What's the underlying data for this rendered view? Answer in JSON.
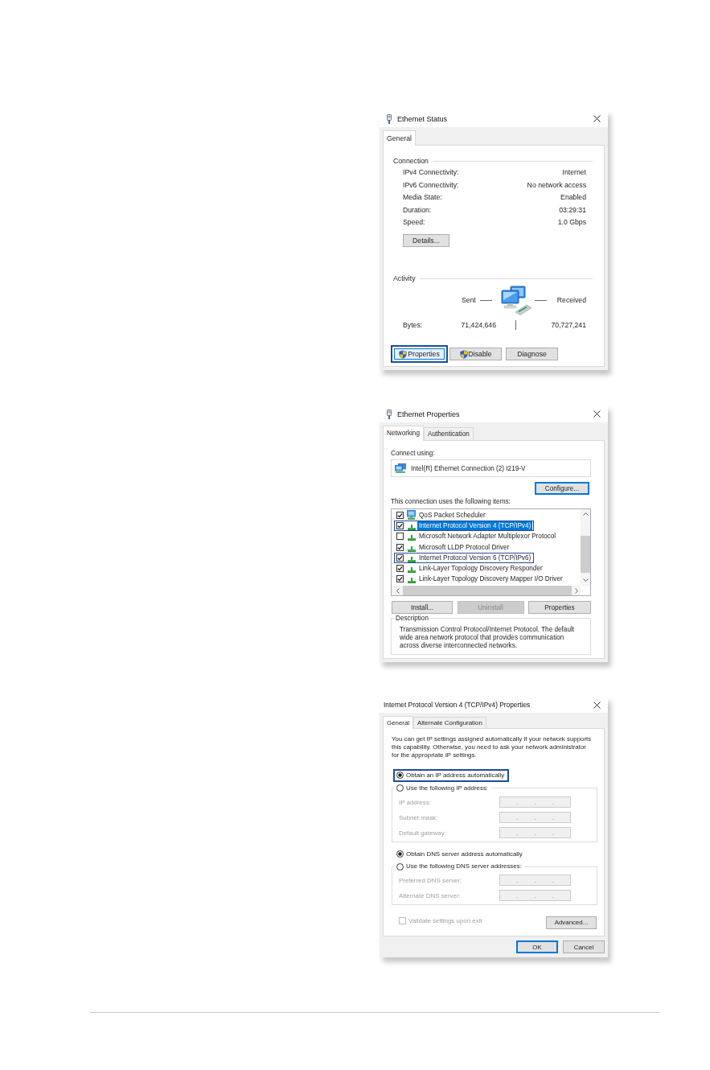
{
  "ethernet_status": {
    "title": "Ethernet Status",
    "tabs": [
      {
        "label": "General",
        "selected": true
      }
    ],
    "connection": {
      "heading": "Connection",
      "rows": [
        {
          "label": "IPv4 Connectivity:",
          "value": "Internet"
        },
        {
          "label": "IPv6 Connectivity:",
          "value": "No network access"
        },
        {
          "label": "Media State:",
          "value": "Enabled"
        },
        {
          "label": "Duration:",
          "value": "03:29:31"
        },
        {
          "label": "Speed:",
          "value": "1.0 Gbps"
        }
      ],
      "details_button": "Details..."
    },
    "activity": {
      "heading": "Activity",
      "sent_label": "Sent",
      "received_label": "Received",
      "bytes_label": "Bytes:",
      "bytes_sent": "71,424,646",
      "bytes_received": "70,727,241"
    },
    "buttons": [
      {
        "label": "Properties",
        "shield": true,
        "outlined": true
      },
      {
        "label": "Disable",
        "shield": true,
        "outlined": false
      },
      {
        "label": "Diagnose",
        "shield": false,
        "outlined": false
      }
    ]
  },
  "ethernet_properties": {
    "title": "Ethernet Properties",
    "tabs": [
      {
        "label": "Networking",
        "selected": true
      },
      {
        "label": "Authentication",
        "selected": false
      }
    ],
    "connect_using_label": "Connect using:",
    "adapter": "Intel(R) Ethernet Connection (2) I219-V",
    "configure_button": {
      "label": "Configure...",
      "default": true
    },
    "items_label": "This connection uses the following items:",
    "items": [
      {
        "kind": "service",
        "label": "QoS Packet Scheduler",
        "checked": true,
        "selected": false,
        "outlined": false
      },
      {
        "kind": "protocol",
        "label": "Internet Protocol Version 4 (TCP/IPv4)",
        "checked": true,
        "selected": true,
        "outlined": true
      },
      {
        "kind": "protocol",
        "label": "Microsoft Network Adapter Multiplexor Protocol",
        "checked": false,
        "selected": false,
        "outlined": false
      },
      {
        "kind": "protocol",
        "label": "Microsoft LLDP Protocol Driver",
        "checked": true,
        "selected": false,
        "outlined": false
      },
      {
        "kind": "protocol",
        "label": "Internet Protocol Version 6 (TCP/IPv6)",
        "checked": true,
        "selected": false,
        "outlined": true
      },
      {
        "kind": "protocol",
        "label": "Link-Layer Topology Discovery Responder",
        "checked": true,
        "selected": false,
        "outlined": false
      },
      {
        "kind": "protocol",
        "label": "Link-Layer Topology Discovery Mapper I/O Driver",
        "checked": true,
        "selected": false,
        "outlined": false
      }
    ],
    "buttons": [
      {
        "label": "Install...",
        "disabled": false
      },
      {
        "label": "Uninstall",
        "disabled": true
      },
      {
        "label": "Properties",
        "disabled": false
      }
    ],
    "description": {
      "heading": "Description",
      "text": "Transmission Control Protocol/Internet Protocol. The default wide area network protocol that provides communication across diverse interconnected networks."
    }
  },
  "ipv4_properties": {
    "title": "Internet Protocol Version 4 (TCP/IPv4) Properties",
    "tabs": [
      {
        "label": "General",
        "selected": true
      },
      {
        "label": "Alternate Configuration",
        "selected": false
      }
    ],
    "intro": "You can get IP settings assigned automatically if your network supports this capability. Otherwise, you need to ask your network administrator for the appropriate IP settings.",
    "octet_separator": ".",
    "ip_options": [
      {
        "label": "Obtain an IP address automatically",
        "selected": true,
        "outlined": true
      },
      {
        "label": "Use the following IP address:",
        "selected": false,
        "outlined": false
      }
    ],
    "ip_fields": [
      {
        "label": "IP address:",
        "disabled": true
      },
      {
        "label": "Subnet mask:",
        "disabled": true
      },
      {
        "label": "Default gateway:",
        "disabled": true
      }
    ],
    "dns_options": [
      {
        "label": "Obtain DNS server address automatically",
        "selected": true,
        "outlined": false
      },
      {
        "label": "Use the following DNS server addresses:",
        "selected": false,
        "outlined": false
      }
    ],
    "dns_fields": [
      {
        "label": "Preferred DNS server:",
        "disabled": true
      },
      {
        "label": "Alternate DNS server:",
        "disabled": true
      }
    ],
    "validate": {
      "label": "Validate settings upon exit",
      "checked": false,
      "disabled": true
    },
    "advanced_button": "Advanced...",
    "buttons": [
      {
        "label": "OK",
        "default": true
      },
      {
        "label": "Cancel",
        "default": false
      }
    ]
  }
}
